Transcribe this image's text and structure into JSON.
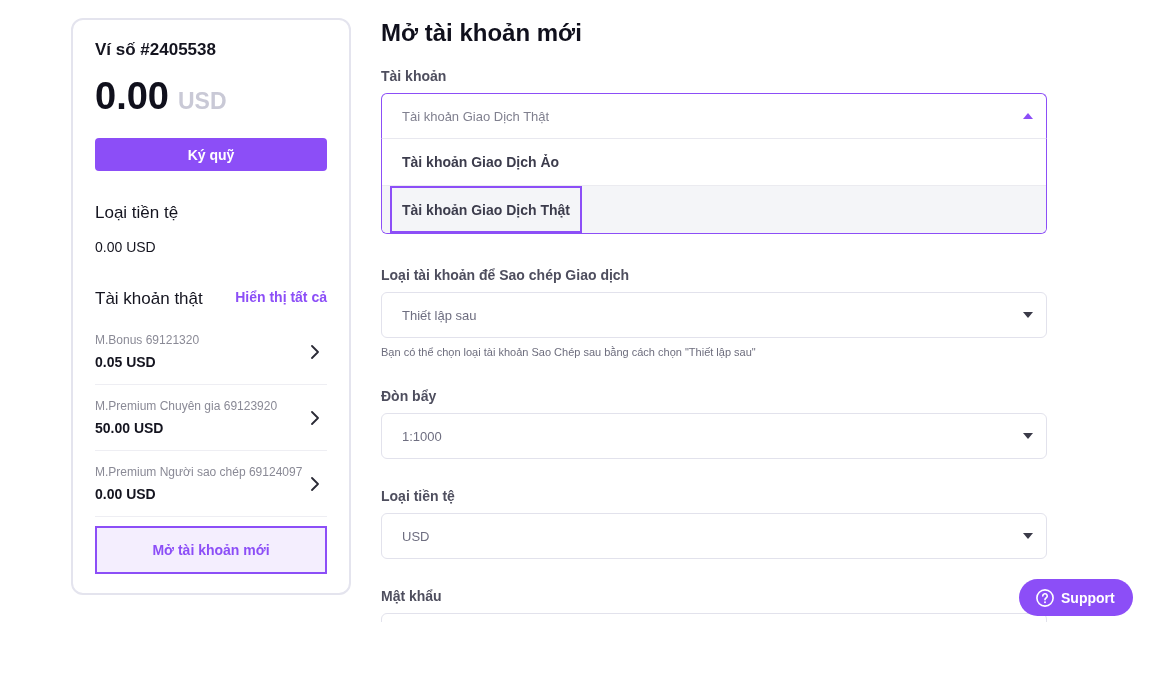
{
  "wallet": {
    "title": "Ví số #2405538",
    "balance": "0.00",
    "currency": "USD",
    "deposit_button": "Ký quỹ",
    "currency_section": {
      "title": "Loại tiền tệ",
      "value": "0.00 USD"
    },
    "accounts_section": {
      "title": "Tài khoản thật",
      "link": "Hiển thị tất cả",
      "accounts": [
        {
          "name": "M.Bonus 69121320",
          "balance": "0.05 USD"
        },
        {
          "name": "M.Premium Chuyên gia 69123920",
          "balance": "50.00 USD"
        },
        {
          "name": "M.Premium Người sao chép 69124097",
          "balance": "0.00 USD"
        }
      ]
    },
    "open_account_button": "Mở tài khoản mới"
  },
  "form": {
    "title": "Mở tài khoản mới",
    "fields": [
      {
        "kind": "select",
        "label": "Tài khoản",
        "value": "Tài khoản Giao Dịch Thật",
        "expanded": true,
        "options": [
          {
            "label": "Tài khoản Giao Dịch Ảo",
            "selected": false
          },
          {
            "label": "Tài khoản Giao Dịch Thật",
            "selected": true
          }
        ]
      },
      {
        "kind": "select",
        "label": "Loại tài khoản để Sao chép Giao dịch",
        "value": "Thiết lập sau",
        "expanded": false,
        "hint": "Bạn có thể chọn loại tài khoản Sao Chép sau bằng cách chọn \"Thiết lập sau\""
      },
      {
        "kind": "select",
        "label": "Đòn bẩy",
        "value": "1:1000",
        "expanded": false
      },
      {
        "kind": "select",
        "label": "Loại tiền tệ",
        "value": "USD",
        "expanded": false
      },
      {
        "kind": "password",
        "label": "Mật khẩu"
      }
    ]
  },
  "support_button": "Support"
}
